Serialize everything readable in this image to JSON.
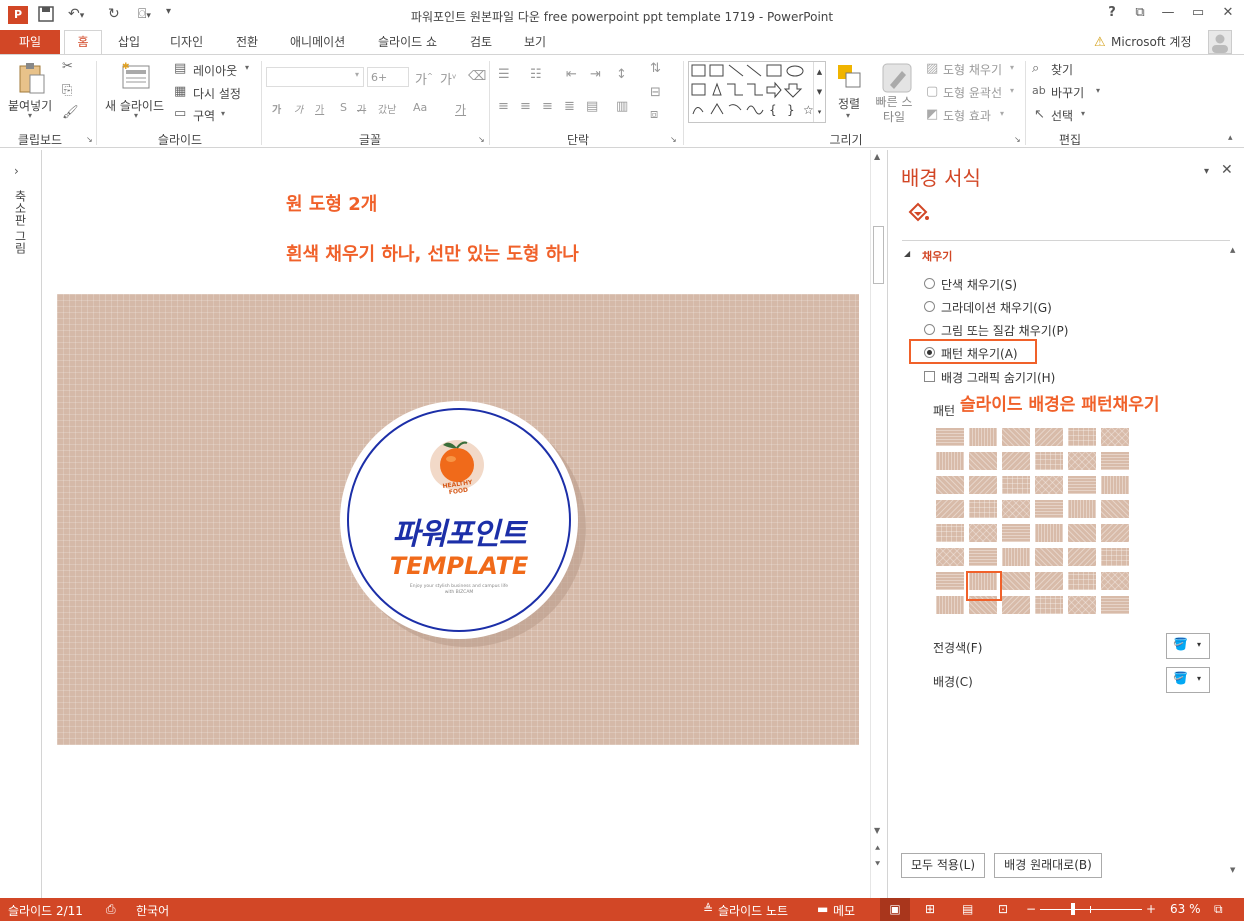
{
  "window": {
    "title": "파워포인트 원본파일 다운 free powerpoint ppt template 1719 - PowerPoint",
    "help": "?",
    "minimize": "—",
    "close": "✕"
  },
  "tabs": [
    "파일",
    "홈",
    "삽입",
    "디자인",
    "전환",
    "애니메이션",
    "슬라이드 쇼",
    "검토",
    "보기"
  ],
  "account": "Microsoft 계정",
  "ribbon": {
    "clipboard": {
      "paste": "붙여넣기",
      "label": "클립보드"
    },
    "slides": {
      "new_slide": "새 슬라이드",
      "layout": "레이아웃",
      "reset": "다시 설정",
      "section": "구역",
      "label": "슬라이드"
    },
    "font": {
      "size": "6+",
      "label": "글꼴",
      "buttons": [
        "가",
        "가",
        "가",
        "S",
        "가",
        "갔낟",
        "Aa",
        "가"
      ]
    },
    "paragraph": {
      "label": "단락"
    },
    "drawing": {
      "arrange": "정렬",
      "quick_styles": "빠른 스타일",
      "shape_fill": "도형 채우기",
      "shape_outline": "도형 윤곽선",
      "shape_effects": "도형 효과",
      "label": "그리기"
    },
    "editing": {
      "find": "찾기",
      "replace": "바꾸기",
      "select": "선택",
      "label": "편집"
    }
  },
  "left_pane": {
    "label": "축소판 그림",
    "expand_icon": "chevron-right"
  },
  "slide": {
    "annotation_1": "원 도형 2개",
    "annotation_2": "흰색 채우기 하나, 선만 있는 도형 하나",
    "logo_badge": "HEALTHY FOOD",
    "title_ko": "파워포인트",
    "title_en": "TEMPLATE",
    "tagline_1": "Enjoy your stylish business and campus life",
    "tagline_2": "with BIZCAM"
  },
  "format_pane": {
    "title": "배경 서식",
    "section": "채우기",
    "options": [
      {
        "label": "단색 채우기(S)",
        "checked": false
      },
      {
        "label": "그라데이션 채우기(G)",
        "checked": false
      },
      {
        "label": "그림 또는 질감 채우기(P)",
        "checked": false
      },
      {
        "label": "패턴 채우기(A)",
        "checked": true
      }
    ],
    "hide_graphics": "배경 그래픽 숨기기(H)",
    "pattern_label": "패턴",
    "callout": "슬라이드 배경은 패턴채우기",
    "foreground": "전경색(F)",
    "background": "배경(C)",
    "apply_all": "모두 적용(L)",
    "reset": "배경 원래대로(B)"
  },
  "status": {
    "slide": "슬라이드 2/11",
    "language": "한국어",
    "notes": "슬라이드 노트",
    "comments": "메모",
    "zoom": "63 %"
  },
  "colors": {
    "accent": "#d24726",
    "callout": "#f0612a",
    "pattern": "#d5b9a8",
    "circle_outline": "#1c2fa8"
  }
}
